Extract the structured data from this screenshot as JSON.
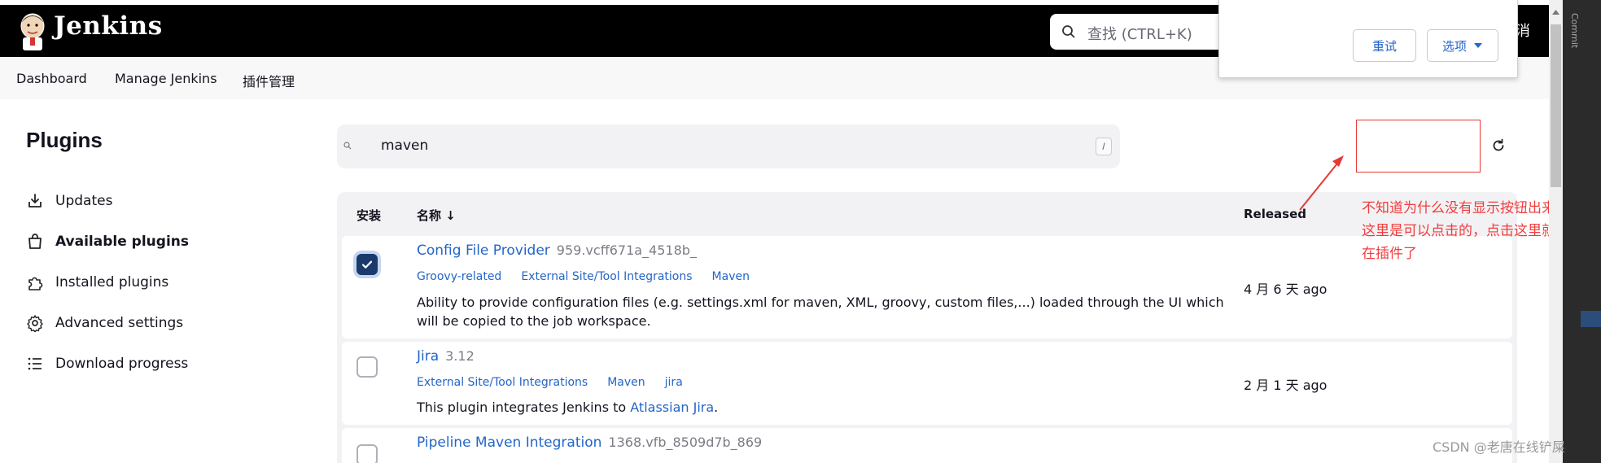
{
  "header": {
    "brand": "Jenkins",
    "search_placeholder": "查找 (CTRL+K)",
    "cancel_fragment": "消"
  },
  "breadcrumb": [
    "Dashboard",
    "Manage Jenkins",
    "插件管理"
  ],
  "sidebar": {
    "title": "Plugins",
    "items": [
      {
        "label": "Updates",
        "icon": "download-icon",
        "active": false
      },
      {
        "label": "Available plugins",
        "icon": "shopping-bag-icon",
        "active": true
      },
      {
        "label": "Installed plugins",
        "icon": "puzzle-icon",
        "active": false
      },
      {
        "label": "Advanced settings",
        "icon": "gear-icon",
        "active": false
      },
      {
        "label": "Download progress",
        "icon": "list-icon",
        "active": false
      }
    ]
  },
  "filter": {
    "value": "maven",
    "shortcut": "/"
  },
  "table": {
    "headers": {
      "install": "安装",
      "name": "名称 ↓",
      "released": "Released"
    },
    "rows": [
      {
        "name": "Config File Provider",
        "version": "959.vcff671a_4518b_",
        "tags": [
          "Groovy-related",
          "External Site/Tool Integrations",
          "Maven"
        ],
        "description": "Ability to provide configuration files (e.g. settings.xml for maven, XML, groovy, custom files,...) loaded through the UI which will be copied to the job workspace.",
        "released": "4 月 6 天 ago",
        "checked": true
      },
      {
        "name": "Jira",
        "version": "3.12",
        "tags": [
          "External Site/Tool Integrations",
          "Maven",
          "jira"
        ],
        "description_prefix": "This plugin integrates Jenkins to ",
        "description_link": "Atlassian Jira",
        "description_suffix": ".",
        "released": "2 月 1 天 ago",
        "checked": false
      },
      {
        "name": "Pipeline Maven Integration",
        "version": "1368.vfb_8509d7b_869",
        "checked": false
      }
    ]
  },
  "annotation": "不知道为什么没有显示按钮出来，但是这里是可以点击的，点击这里就可以现在插件了",
  "popup": {
    "retry": "重试",
    "options": "选项"
  },
  "rail": {
    "label": "Commit"
  },
  "watermark": "CSDN @老唐在线铲屎",
  "colors": {
    "link": "#2465c8",
    "annotation": "#f03d3d",
    "header_bg": "#000000"
  }
}
